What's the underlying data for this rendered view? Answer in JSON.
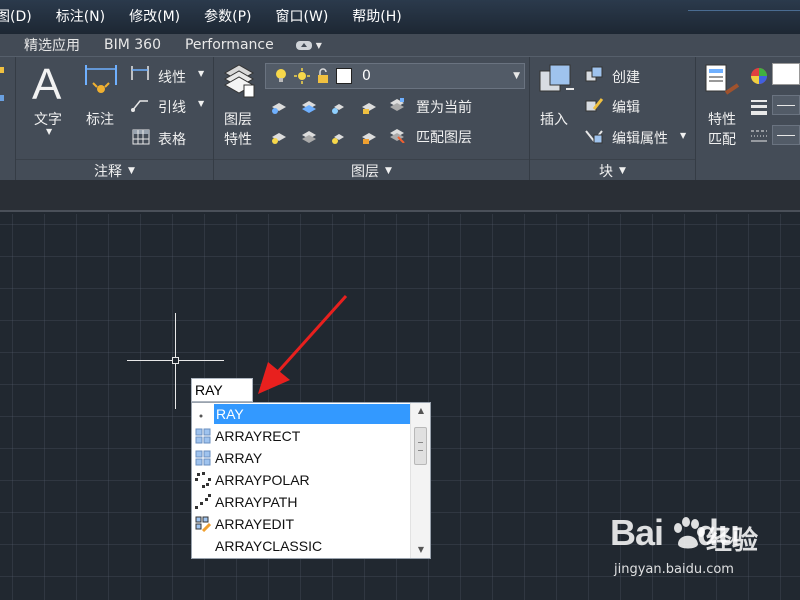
{
  "menubar": {
    "items": [
      "图(D)",
      "标注(N)",
      "修改(M)",
      "参数(P)",
      "窗口(W)",
      "帮助(H)"
    ]
  },
  "tabs": {
    "items": [
      "精选应用",
      "BIM 360",
      "Performance"
    ]
  },
  "ribbon": {
    "annotation": {
      "text_label": "文字",
      "dimension_label": "标注",
      "linetype_label": "线性",
      "leader_label": "引线",
      "table_label": "表格",
      "panel_title": "注释"
    },
    "layers": {
      "layer_properties_label_1": "图层",
      "layer_properties_label_2": "特性",
      "current_layer": "0",
      "set_current_label": "置为当前",
      "match_layer_label": "匹配图层",
      "panel_title": "图层"
    },
    "block": {
      "insert_label": "插入",
      "create_label": "创建",
      "edit_label": "编辑",
      "edit_attributes_label": "编辑属性",
      "panel_title": "块"
    },
    "properties": {
      "match_label_1": "特性",
      "match_label_2": "匹配"
    }
  },
  "command": {
    "input_value": "RAY"
  },
  "autocomplete": {
    "items": [
      {
        "label": "RAY",
        "icon": "ray-icon",
        "selected": true
      },
      {
        "label": "ARRAYRECT",
        "icon": "array-rect-icon"
      },
      {
        "label": "ARRAY",
        "icon": "array-icon"
      },
      {
        "label": "ARRAYPOLAR",
        "icon": "array-polar-icon"
      },
      {
        "label": "ARRAYPATH",
        "icon": "array-path-icon"
      },
      {
        "label": "ARRAYEDIT",
        "icon": "array-edit-icon"
      },
      {
        "label": "ARRAYCLASSIC",
        "icon": ""
      }
    ]
  },
  "watermark": {
    "logo_text": "Bai",
    "logo_text_2": "du",
    "site_name": "经验",
    "url": "jingyan.baidu.com"
  },
  "colors": {
    "selection": "#3399ff",
    "arrow": "#e8201e",
    "canvas": "#212830",
    "ribbon": "#444c57"
  }
}
